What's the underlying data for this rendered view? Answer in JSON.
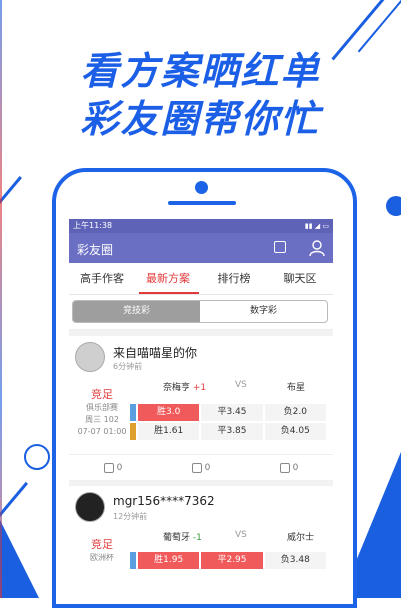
{
  "headline": {
    "line1": "看方案晒红单",
    "line2": "彩友圈帮你忙"
  },
  "status_bar": {
    "time": "上午11:38"
  },
  "app": {
    "title": "彩友圈"
  },
  "tabs": [
    {
      "label": "高手作客",
      "active": false
    },
    {
      "label": "最新方案",
      "active": true
    },
    {
      "label": "排行榜",
      "active": false
    },
    {
      "label": "聊天区",
      "active": false
    }
  ],
  "segment": [
    {
      "label": "竞技彩",
      "active": true
    },
    {
      "label": "数字彩",
      "active": false
    }
  ],
  "posts": [
    {
      "user": "来自喵喵星的你",
      "time": "6分钟前",
      "lottery": "竞足",
      "league": "俱乐部赛",
      "round": "周三 102",
      "kickoff": "07-07 01:00",
      "home": "奈梅亨",
      "handicap": "+1",
      "vs": "VS",
      "away": "布星",
      "odds_row1": [
        "胜3.0",
        "平3.45",
        "负2.0"
      ],
      "odds_row2": [
        "胜1.61",
        "平3.85",
        "负4.05"
      ],
      "likes": "0",
      "dislikes": "0",
      "comments": "0"
    },
    {
      "user": "mgr156****7362",
      "time": "12分钟前",
      "lottery": "竞足",
      "league": "欧洲杯",
      "home": "葡萄牙",
      "handicap": "-1",
      "vs": "VS",
      "away": "威尔士",
      "odds_row1": [
        "胜1.95",
        "平2.95",
        "负3.48"
      ]
    }
  ],
  "colors": {
    "brand_blue": "#1b5fe6",
    "appbar": "#6b6fc4",
    "accent_red": "#e23a3a"
  }
}
